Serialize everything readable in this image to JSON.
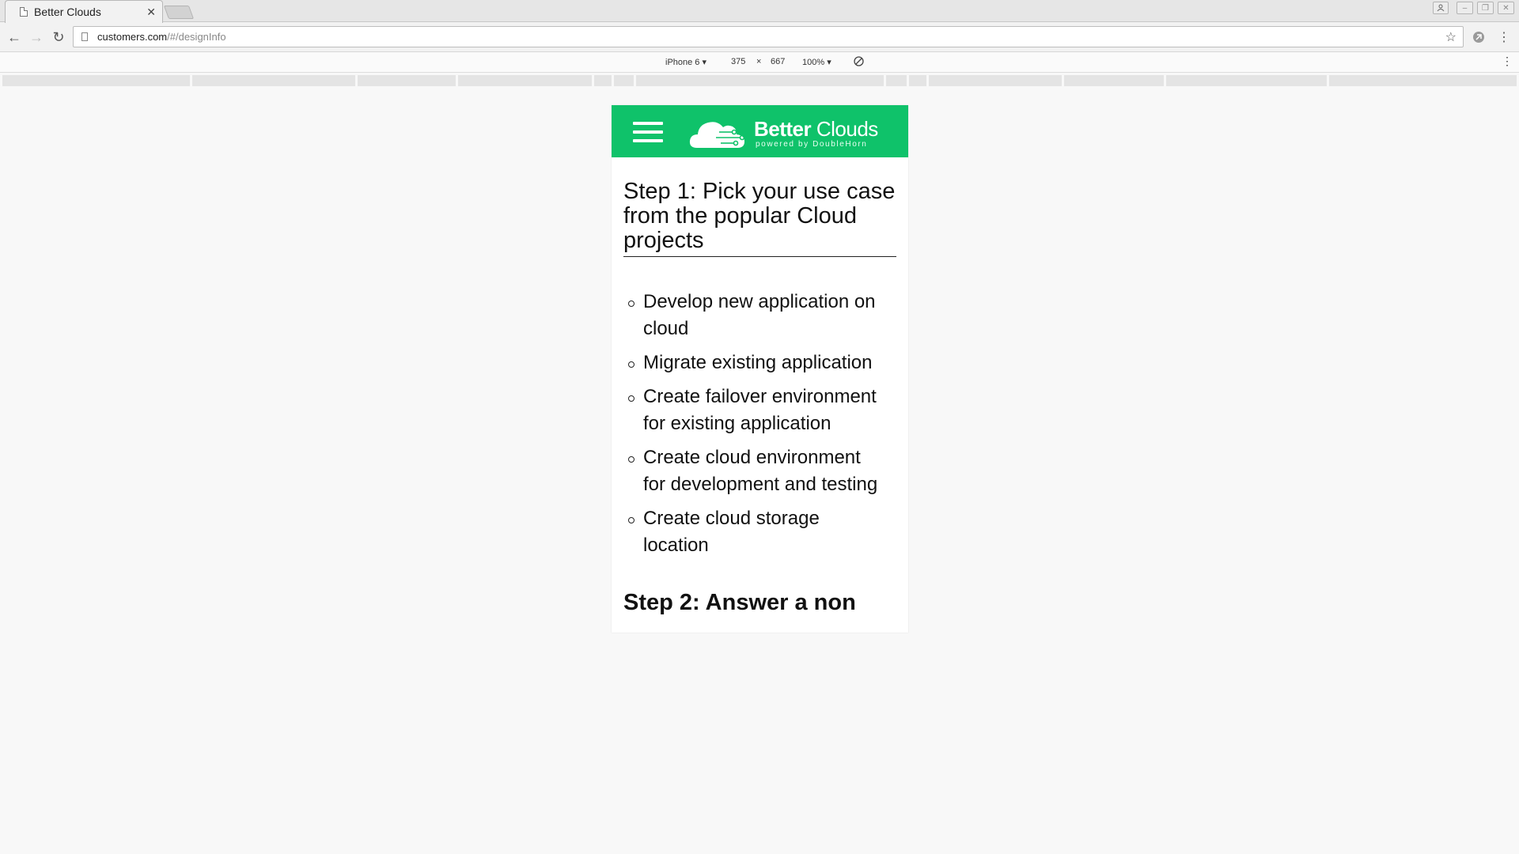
{
  "browser": {
    "tab_title": "Better Clouds",
    "url_host": "customers.com",
    "url_path": "/#/designInfo"
  },
  "devicebar": {
    "device": "iPhone 6 ▾",
    "width": "375",
    "times": "×",
    "height": "667",
    "zoom": "100% ▾"
  },
  "app": {
    "brand_bold": "Better",
    "brand_light": "Clouds",
    "brand_sub": "powered by DoubleHorn",
    "accent": "#0fc26a"
  },
  "content": {
    "step1_heading": "Step 1: Pick your use case from the popular Cloud projects",
    "use_cases": [
      "Develop new application on cloud",
      "Migrate existing application",
      "Create failover environment for existing application",
      "Create cloud environment for development and testing",
      "Create cloud storage location"
    ],
    "step2_heading": "Step 2: Answer a non"
  }
}
